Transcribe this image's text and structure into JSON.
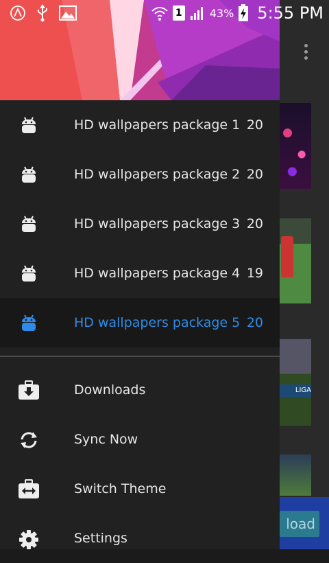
{
  "status_bar": {
    "battery_percent": "43%",
    "time": "5:55 PM",
    "sim_slot": "1",
    "icons": [
      "android-circle-icon",
      "usb-icon",
      "image-icon",
      "wifi-icon",
      "sim-icon",
      "signal-icon",
      "battery-charging-icon"
    ]
  },
  "drawer": {
    "packages": [
      {
        "label": "HD wallpapers package 1",
        "count": "20",
        "active": false
      },
      {
        "label": "HD wallpapers package 2",
        "count": "20",
        "active": false
      },
      {
        "label": "HD wallpapers package 3",
        "count": "20",
        "active": false
      },
      {
        "label": "HD wallpapers package 4",
        "count": "19",
        "active": false
      },
      {
        "label": "HD wallpapers package 5",
        "count": "20",
        "active": true
      }
    ],
    "menu": [
      {
        "label": "Downloads",
        "icon": "download-icon"
      },
      {
        "label": "Sync Now",
        "icon": "sync-icon"
      },
      {
        "label": "Switch Theme",
        "icon": "switch-theme-icon"
      },
      {
        "label": "Settings",
        "icon": "gear-icon"
      }
    ]
  },
  "background": {
    "download_button_label": "load"
  },
  "colors": {
    "accent": "#2d8ce8",
    "drawer_bg": "#212121"
  }
}
